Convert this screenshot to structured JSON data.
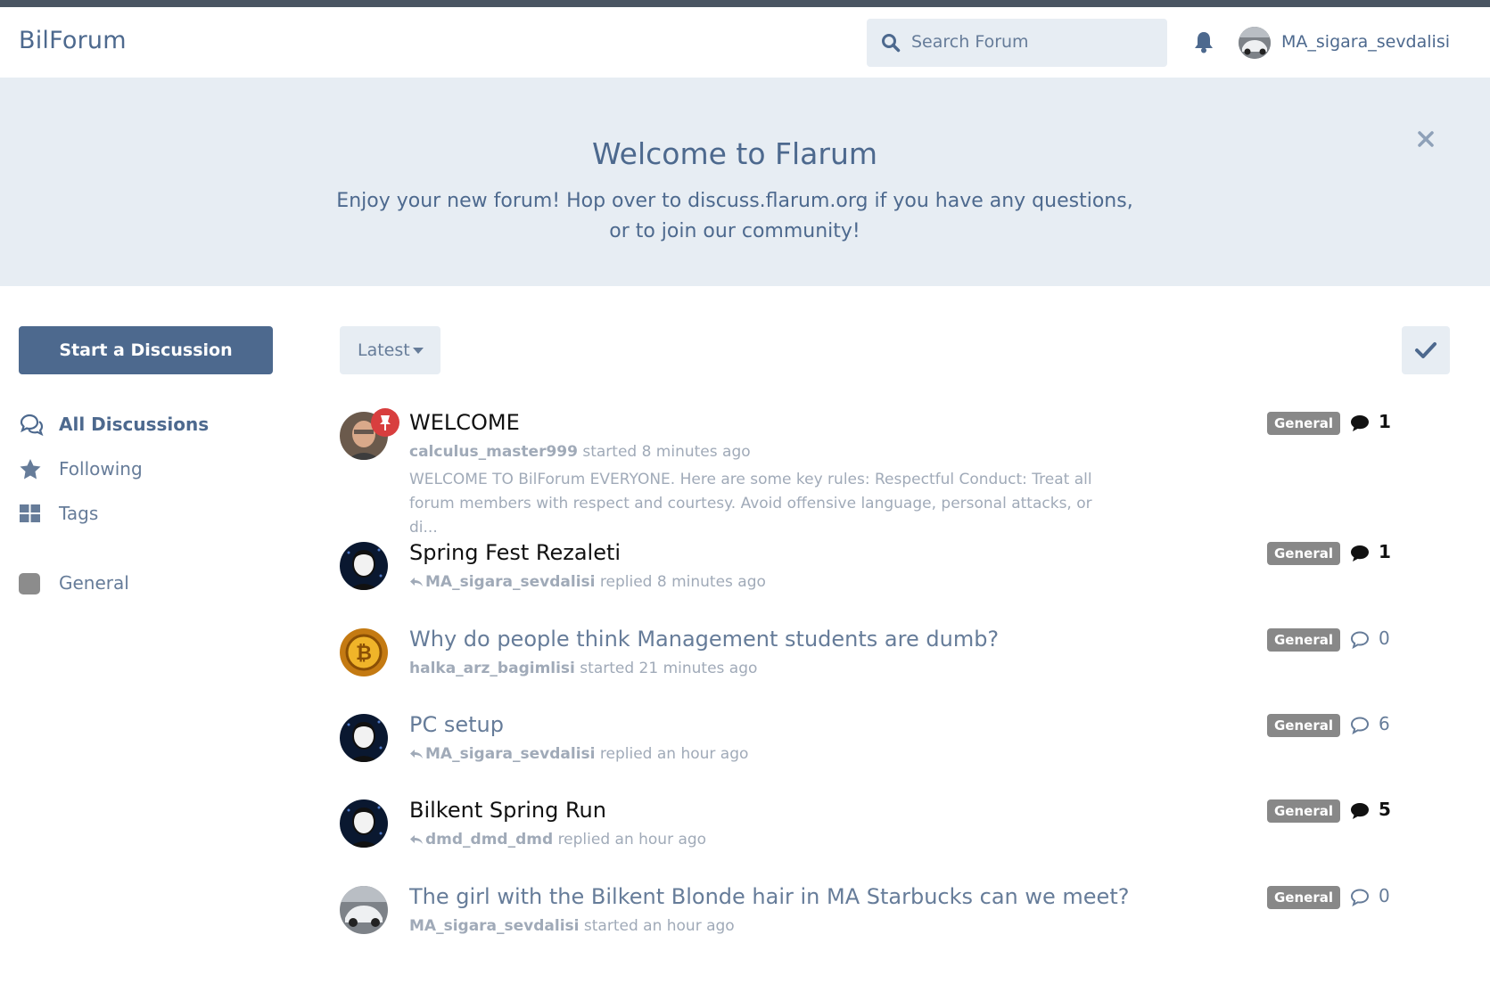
{
  "app": {
    "brand": "BilForum"
  },
  "header": {
    "search_placeholder": "Search Forum",
    "username": "MA_sigara_sevdalisi"
  },
  "hero": {
    "title": "Welcome to Flarum",
    "text": "Enjoy your new forum! Hop over to discuss.flarum.org if you have any questions, or to join our community!"
  },
  "sidebar": {
    "start_label": "Start a Discussion",
    "items": [
      {
        "label": "All Discussions",
        "icon": "comments-icon",
        "active": true
      },
      {
        "label": "Following",
        "icon": "star-icon"
      },
      {
        "label": "Tags",
        "icon": "grid-icon"
      },
      {
        "label": "General",
        "icon": "tag-square-icon",
        "color": "#8c8c8c"
      }
    ]
  },
  "toolbar": {
    "sort_label": "Latest"
  },
  "discussions": [
    {
      "title": "WELCOME",
      "author": "calculus_master999",
      "action": "started 8 minutes ago",
      "excerpt": "WELCOME TO BilForum EVERYONE. Here are some key rules: Respectful Conduct: Treat all forum members with respect and courtesy. Avoid offensive language, personal attacks, or di...",
      "tag": "General",
      "count": "1",
      "unread": true,
      "pinned": true
    },
    {
      "title": "Spring Fest Rezaleti",
      "author": "MA_sigara_sevdalisi",
      "action": "replied 8 minutes ago",
      "tag": "General",
      "count": "1",
      "unread": true
    },
    {
      "title": "Why do people think Management students are dumb?",
      "author": "halka_arz_bagimlisi",
      "action": "started 21 minutes ago",
      "tag": "General",
      "count": "0",
      "unread": false
    },
    {
      "title": "PC setup",
      "author": "MA_sigara_sevdalisi",
      "action": "replied an hour ago",
      "tag": "General",
      "count": "6",
      "unread": false
    },
    {
      "title": "Bilkent Spring Run",
      "author": "dmd_dmd_dmd",
      "action": "replied an hour ago",
      "tag": "General",
      "count": "5",
      "unread": true
    },
    {
      "title": "The girl with the Bilkent Blonde hair in MA Starbucks can we meet?",
      "author": "MA_sigara_sevdalisi",
      "action": "started an hour ago",
      "tag": "General",
      "count": "0",
      "unread": false
    }
  ],
  "colors": {
    "primary": "#4d698e",
    "hero_bg": "#e7edf3",
    "tag_general": "#888888",
    "pin": "#d83e3e"
  }
}
